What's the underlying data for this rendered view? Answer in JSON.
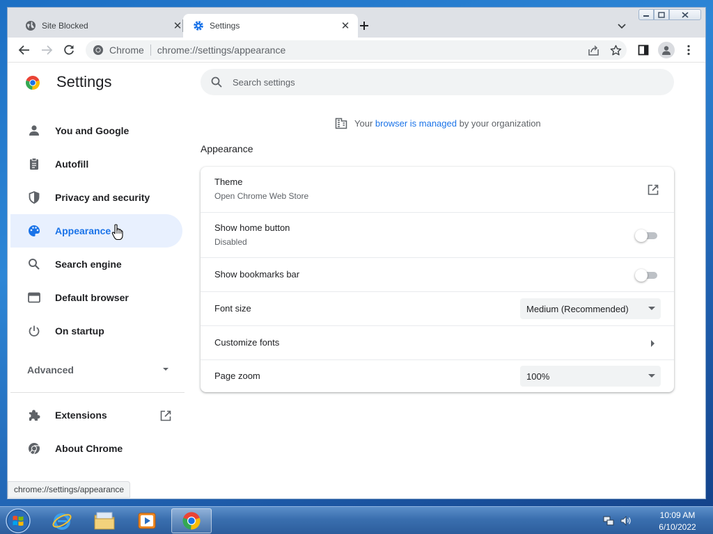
{
  "browser": {
    "tabs": [
      {
        "title": "Site Blocked",
        "icon": "globe-icon",
        "active": false
      },
      {
        "title": "Settings",
        "icon": "gear-icon",
        "active": true
      }
    ],
    "omnibox": {
      "site_label": "Chrome",
      "url": "chrome://settings/appearance"
    },
    "status_url": "chrome://settings/appearance"
  },
  "settings": {
    "title": "Settings",
    "search_placeholder": "Search settings",
    "nav": [
      {
        "label": "You and Google",
        "icon": "person-icon"
      },
      {
        "label": "Autofill",
        "icon": "clipboard-icon"
      },
      {
        "label": "Privacy and security",
        "icon": "shield-icon"
      },
      {
        "label": "Appearance",
        "icon": "palette-icon",
        "selected": true
      },
      {
        "label": "Search engine",
        "icon": "search-icon"
      },
      {
        "label": "Default browser",
        "icon": "browser-window-icon"
      },
      {
        "label": "On startup",
        "icon": "power-icon"
      }
    ],
    "advanced_label": "Advanced",
    "footer_nav": [
      {
        "label": "Extensions",
        "icon": "puzzle-icon"
      },
      {
        "label": "About Chrome",
        "icon": "chrome-icon"
      }
    ],
    "managed": {
      "prefix": "Your",
      "link": "browser is managed",
      "suffix": "by your organization"
    },
    "section_title": "Appearance",
    "rows": {
      "theme": {
        "label": "Theme",
        "sub": "Open Chrome Web Store"
      },
      "home_button": {
        "label": "Show home button",
        "sub": "Disabled",
        "enabled": false
      },
      "bookmarks_bar": {
        "label": "Show bookmarks bar",
        "enabled": false
      },
      "font_size": {
        "label": "Font size",
        "value": "Medium (Recommended)"
      },
      "customize_fonts": {
        "label": "Customize fonts"
      },
      "page_zoom": {
        "label": "Page zoom",
        "value": "100%"
      }
    }
  },
  "taskbar": {
    "apps": [
      "internet-explorer-icon",
      "file-explorer-icon",
      "media-player-icon",
      "chrome-icon"
    ],
    "time": "10:09 AM",
    "date": "6/10/2022"
  },
  "colors": {
    "accent": "#1a73e8",
    "selected_nav_bg": "#e8f0fe"
  }
}
